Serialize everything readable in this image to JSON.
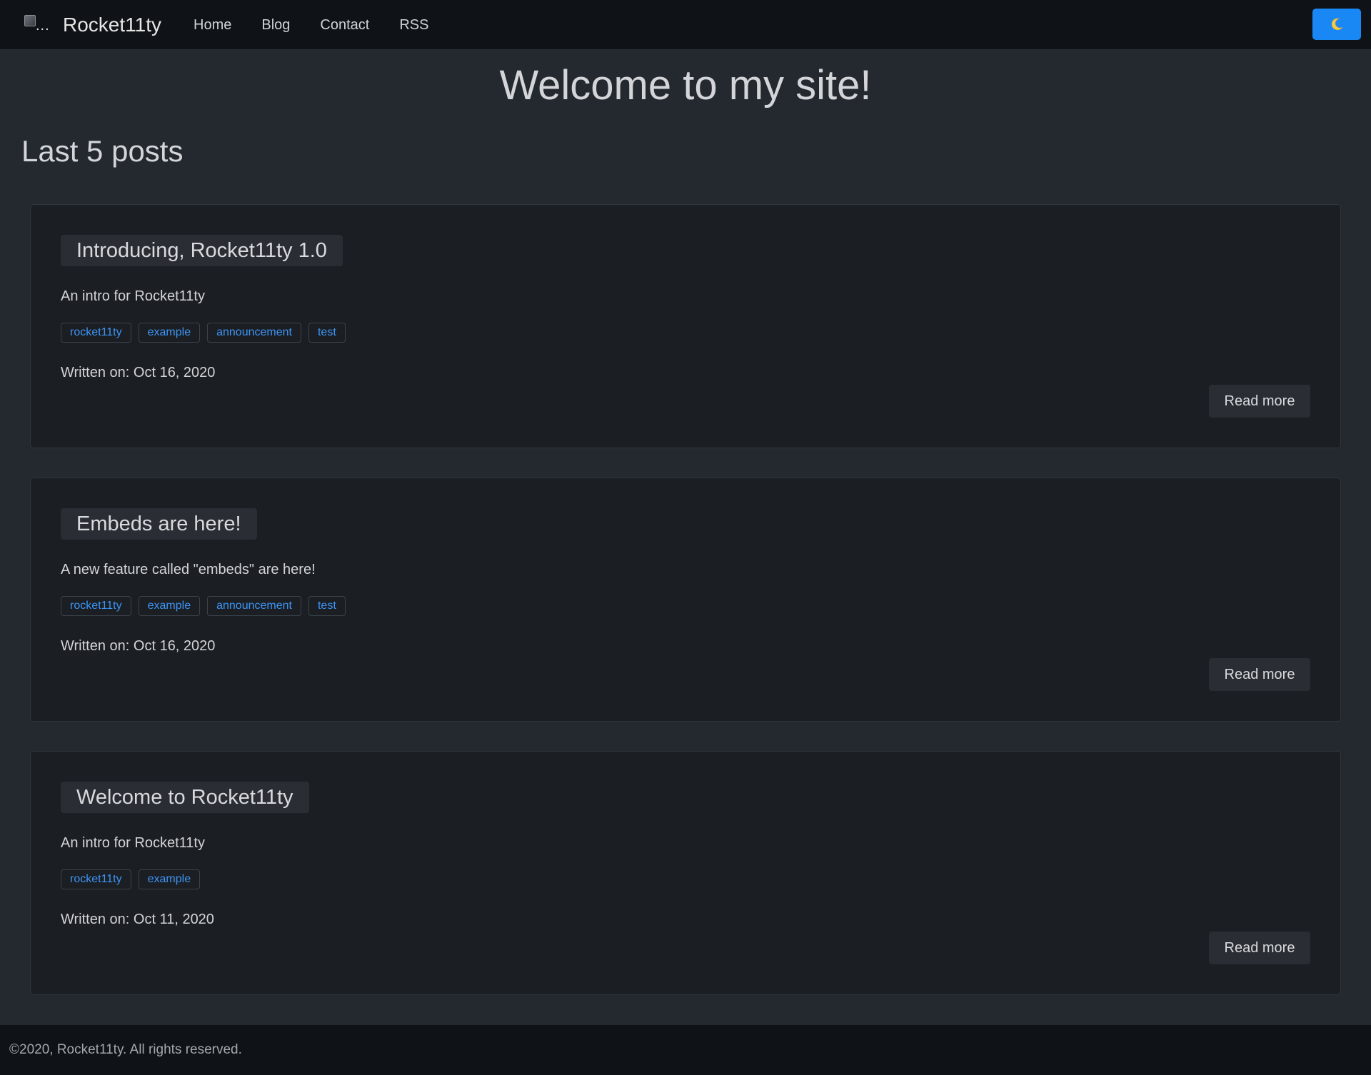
{
  "navbar": {
    "brand_logo_alt": "...",
    "brand_name": "Rocket11ty",
    "links": [
      {
        "label": "Home"
      },
      {
        "label": "Blog"
      },
      {
        "label": "Contact"
      },
      {
        "label": "RSS"
      }
    ],
    "theme_toggle_icon": "moon-icon",
    "accent_color": "#1a88f4"
  },
  "main": {
    "title": "Welcome to my site!",
    "section_title": "Last 5 posts",
    "posts": [
      {
        "title": "Introducing, Rocket11ty 1.0",
        "description": "An intro for Rocket11ty",
        "tags": [
          "rocket11ty",
          "example",
          "announcement",
          "test"
        ],
        "date": "Written on: Oct 16, 2020",
        "read_more_label": "Read more"
      },
      {
        "title": "Embeds are here!",
        "description": "A new feature called \"embeds\" are here!",
        "tags": [
          "rocket11ty",
          "example",
          "announcement",
          "test"
        ],
        "date": "Written on: Oct 16, 2020",
        "read_more_label": "Read more"
      },
      {
        "title": "Welcome to Rocket11ty",
        "description": "An intro for Rocket11ty",
        "tags": [
          "rocket11ty",
          "example"
        ],
        "date": "Written on: Oct 11, 2020",
        "read_more_label": "Read more"
      }
    ]
  },
  "footer": {
    "text": "©2020, Rocket11ty. All rights reserved."
  }
}
